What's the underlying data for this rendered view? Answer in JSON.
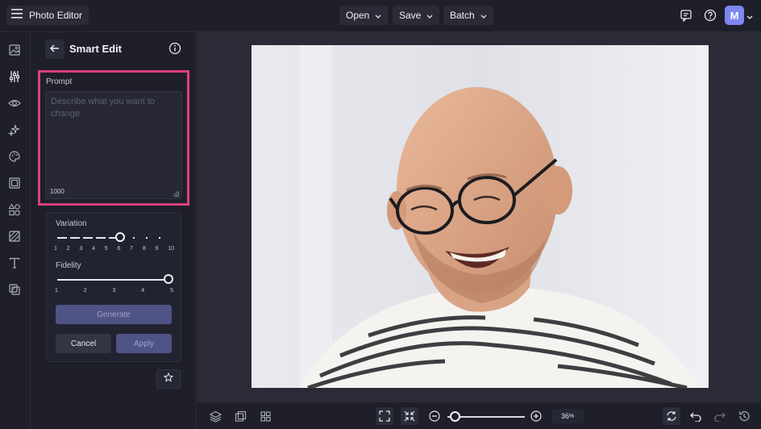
{
  "header": {
    "app_title": "Photo Editor",
    "menus": [
      {
        "label": "Open"
      },
      {
        "label": "Save"
      },
      {
        "label": "Batch"
      }
    ],
    "avatar_initial": "M"
  },
  "rail": {
    "items": [
      "image-icon",
      "sliders-icon",
      "eye-icon",
      "sparkles-icon",
      "palette-icon",
      "frame-icon",
      "shapes-icon",
      "texture-icon",
      "text-icon",
      "overlay-icon"
    ],
    "active_index": 1
  },
  "panel": {
    "title": "Smart Edit",
    "prompt": {
      "label": "Prompt",
      "placeholder": "Describe what you want to change",
      "value": "",
      "char_count": "1000"
    },
    "variation": {
      "label": "Variation",
      "ticks": [
        "1",
        "2",
        "3",
        "4",
        "5",
        "6",
        "7",
        "8",
        "9",
        "10"
      ],
      "value": 6
    },
    "fidelity": {
      "label": "Fidelity",
      "ticks": [
        "1",
        "2",
        "3",
        "4",
        "5"
      ],
      "value": 5
    },
    "generate_label": "Generate",
    "cancel_label": "Cancel",
    "apply_label": "Apply"
  },
  "canvas": {
    "image_description_icon": "portrait-photo"
  },
  "bottombar": {
    "zoom_percent": "36",
    "zoom_symbol": "%"
  },
  "colors": {
    "background": "#1e1f29",
    "canvas": "#2a2b36",
    "highlight": "#dd3f7a",
    "accent": "#7d86f1",
    "button_primary": "#4f5386"
  }
}
